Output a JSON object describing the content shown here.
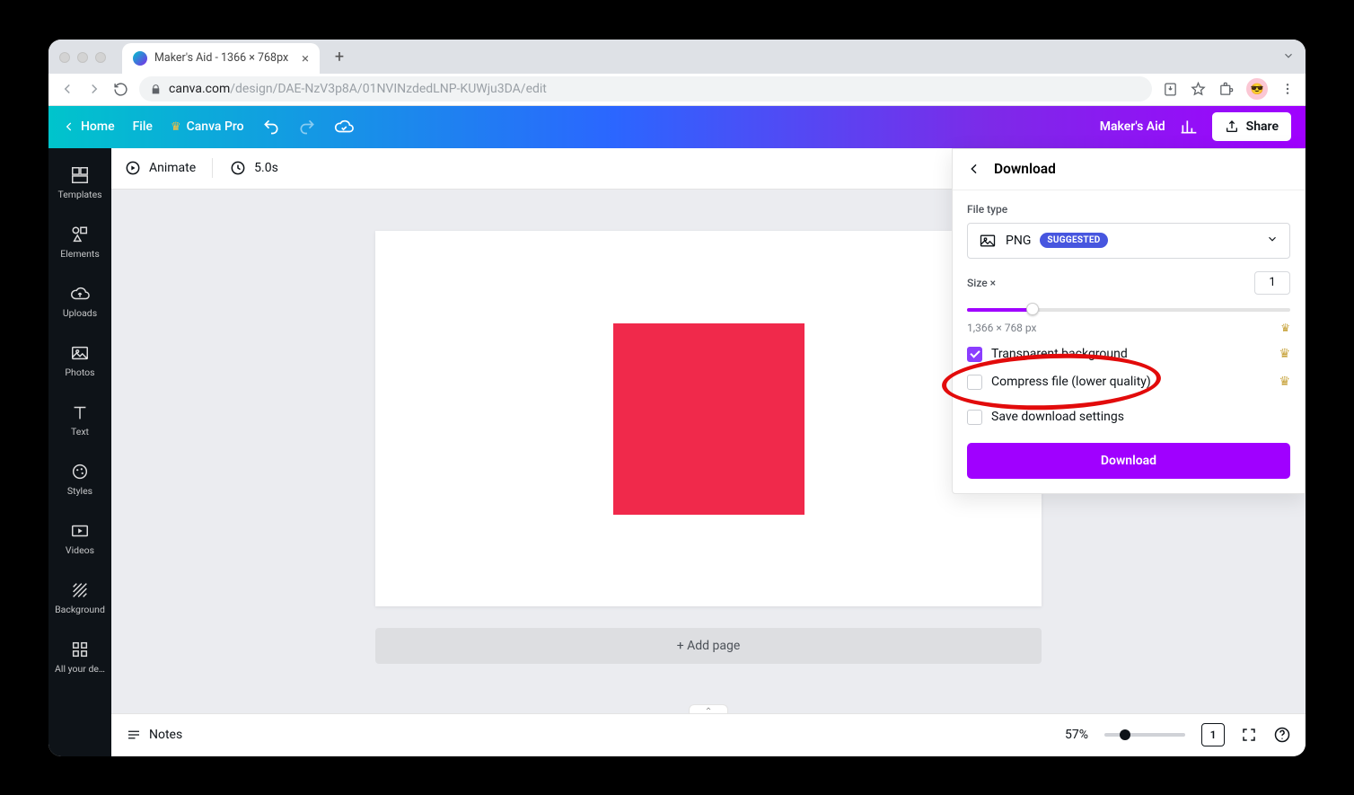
{
  "browser": {
    "tab_title": "Maker's Aid - 1366 × 768px",
    "url_domain": "canva.com",
    "url_path": "/design/DAE-NzV3p8A/01NVINzdedLNP-KUWju3DA/edit"
  },
  "header": {
    "home": "Home",
    "file": "File",
    "pro": "Canva Pro",
    "project_name": "Maker's Aid",
    "share": "Share"
  },
  "siderail": {
    "items": [
      {
        "label": "Templates"
      },
      {
        "label": "Elements"
      },
      {
        "label": "Uploads"
      },
      {
        "label": "Photos"
      },
      {
        "label": "Text"
      },
      {
        "label": "Styles"
      },
      {
        "label": "Videos"
      },
      {
        "label": "Background"
      },
      {
        "label": "All your de…"
      }
    ]
  },
  "toolbar": {
    "animate": "Animate",
    "duration": "5.0s"
  },
  "canvas": {
    "add_page": "+ Add page"
  },
  "download": {
    "title": "Download",
    "file_type_label": "File type",
    "file_type_value": "PNG",
    "file_type_badge": "SUGGESTED",
    "size_label": "Size ×",
    "size_value": "1",
    "dimensions": "1,366 × 768 px",
    "transparent_bg": "Transparent background",
    "compress": "Compress file (lower quality)",
    "save_settings": "Save download settings",
    "button": "Download"
  },
  "footer": {
    "notes": "Notes",
    "zoom": "57%",
    "page_num": "1"
  }
}
